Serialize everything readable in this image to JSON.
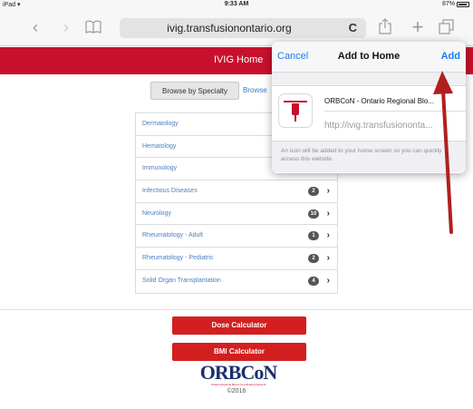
{
  "status_bar": {
    "device": "iPad",
    "wifi_icon": "wifi-icon",
    "time": "9:33 AM",
    "battery": "87%"
  },
  "browser": {
    "url": "ivig.transfusionontario.org",
    "reload_glyph": "C",
    "icons": [
      "back-icon",
      "forward-icon",
      "bookmarks-icon",
      "reload-icon",
      "share-icon",
      "new-tab-icon",
      "tabs-icon"
    ]
  },
  "site": {
    "header_title": "IVIG Home",
    "tabs": [
      {
        "label": "Browse by Specialty"
      },
      {
        "label": "Browse"
      }
    ],
    "specialties": [
      {
        "label": "Dermatology",
        "count": ""
      },
      {
        "label": "Hematology",
        "count": ""
      },
      {
        "label": "Immunology",
        "count": ""
      },
      {
        "label": "Infectious Diseases",
        "count": "2"
      },
      {
        "label": "Neurology",
        "count": "10"
      },
      {
        "label": "Rheumatology - Adult",
        "count": "1"
      },
      {
        "label": "Rheumatology - Pediatric",
        "count": "2"
      },
      {
        "label": "Solid Organ Transplantation",
        "count": "4"
      }
    ],
    "buttons": {
      "dose": "Dose Calculator",
      "bmi": "BMI Calculator"
    },
    "logo_text": "ORBCoN",
    "logo_subtitle": "Ontario Regional Blood Coordinating Network",
    "copyright": "©2016"
  },
  "popover": {
    "cancel": "Cancel",
    "title": "Add to Home",
    "add": "Add",
    "app_name": "ORBCoN - Ontario Regional Blo...",
    "app_url": "http://ivig.transfusiononta...",
    "note": "An icon will be added to your home screen so you can quickly access this website."
  },
  "colors": {
    "brand_red": "#c8102e",
    "ios_blue": "#1a7cf6",
    "link_blue": "#4a7fc1",
    "annotation_arrow": "#b0201c"
  }
}
